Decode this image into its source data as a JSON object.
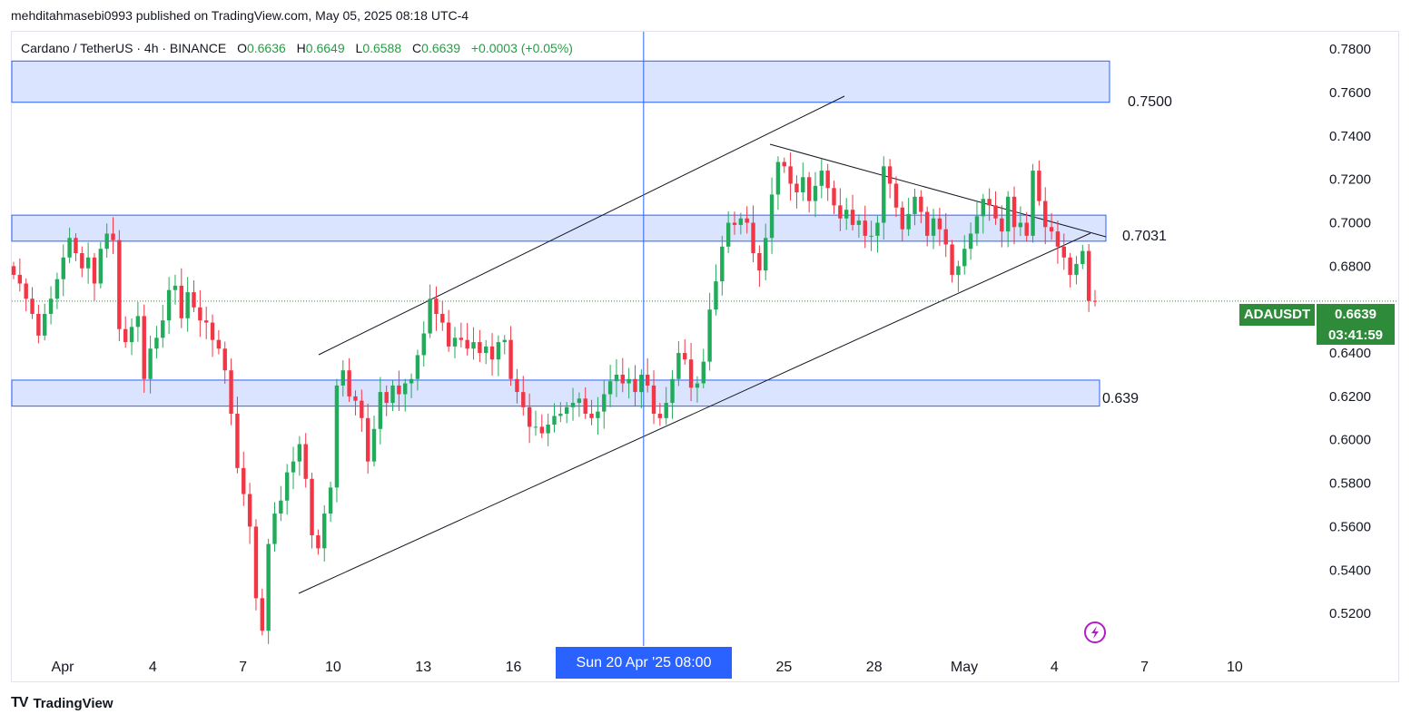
{
  "publish_line": "mehditahmasebi0993 published on TradingView.com, May 05, 2025 08:18 UTC-4",
  "legend": {
    "symbol": "Cardano / TetherUS · 4h · BINANCE",
    "open_label": "O",
    "open": "0.6636",
    "high_label": "H",
    "high": "0.6649",
    "low_label": "L",
    "low": "0.6588",
    "close_label": "C",
    "close": "0.6639",
    "change": "+0.0003 (+0.05%)"
  },
  "price_badge": {
    "symbol": "ADAUSDT",
    "price": "0.6639",
    "countdown": "03:41:59"
  },
  "crosshair_time_label": "Sun 20 Apr '25   08:00",
  "level_labels": {
    "upper": "0.7500",
    "middle": "0.7031",
    "lower": "0.639"
  },
  "brand": "TradingView",
  "colors": {
    "up": "#22ab5a",
    "down": "#f23645",
    "zone_fill": "#dbe4ff",
    "zone_stroke": "#2962ff",
    "crosshair": "#2962ff",
    "badge": "#2e8b3a"
  },
  "chart_data": {
    "type": "candlestick",
    "ylim": [
      0.505,
      0.788
    ],
    "y_ticks": [
      "0.7800",
      "0.7600",
      "0.7400",
      "0.7200",
      "0.7000",
      "0.6800",
      "0.6400",
      "0.6200",
      "0.6000",
      "0.5800",
      "0.5600",
      "0.5400",
      "0.5200"
    ],
    "x_ticks": [
      {
        "label": "Apr",
        "day": 1
      },
      {
        "label": "4",
        "day": 4
      },
      {
        "label": "7",
        "day": 7
      },
      {
        "label": "10",
        "day": 10
      },
      {
        "label": "13",
        "day": 13
      },
      {
        "label": "16",
        "day": 16
      },
      {
        "label": "25",
        "day": 25
      },
      {
        "label": "28",
        "day": 28
      },
      {
        "label": "May",
        "day": 31
      },
      {
        "label": "4",
        "day": 34
      },
      {
        "label": "7",
        "day": 37
      },
      {
        "label": "10",
        "day": 40
      }
    ],
    "zones": [
      {
        "from": 0.7555,
        "to": 0.7745
      },
      {
        "from": 0.6915,
        "to": 0.7035
      },
      {
        "from": 0.6155,
        "to": 0.6275
      }
    ],
    "crosshair_day": 20.33,
    "last_price": 0.6639,
    "close_series": [
      0.676,
      0.672,
      0.665,
      0.658,
      0.648,
      0.658,
      0.665,
      0.674,
      0.684,
      0.693,
      0.686,
      0.679,
      0.684,
      0.672,
      0.688,
      0.695,
      0.692,
      0.651,
      0.645,
      0.652,
      0.657,
      0.628,
      0.642,
      0.647,
      0.655,
      0.669,
      0.671,
      0.656,
      0.668,
      0.661,
      0.655,
      0.654,
      0.646,
      0.642,
      0.632,
      0.612,
      0.587,
      0.575,
      0.56,
      0.527,
      0.512,
      0.552,
      0.566,
      0.572,
      0.585,
      0.59,
      0.598,
      0.582,
      0.556,
      0.55,
      0.566,
      0.578,
      0.625,
      0.632,
      0.62,
      0.618,
      0.61,
      0.59,
      0.605,
      0.622,
      0.617,
      0.625,
      0.621,
      0.626,
      0.628,
      0.639,
      0.649,
      0.665,
      0.658,
      0.654,
      0.643,
      0.647,
      0.646,
      0.642,
      0.645,
      0.64,
      0.643,
      0.637,
      0.645,
      0.646,
      0.628,
      0.622,
      0.615,
      0.606,
      0.606,
      0.603,
      0.607,
      0.611,
      0.612,
      0.615,
      0.617,
      0.619,
      0.612,
      0.61,
      0.613,
      0.621,
      0.627,
      0.63,
      0.626,
      0.628,
      0.622,
      0.63,
      0.625,
      0.612,
      0.61,
      0.617,
      0.628,
      0.64,
      0.637,
      0.624,
      0.626,
      0.636,
      0.66,
      0.673,
      0.689,
      0.7,
      0.699,
      0.702,
      0.7,
      0.686,
      0.678,
      0.693,
      0.713,
      0.728,
      0.726,
      0.718,
      0.714,
      0.721,
      0.71,
      0.717,
      0.724,
      0.716,
      0.708,
      0.702,
      0.706,
      0.699,
      0.701,
      0.694,
      0.694,
      0.7,
      0.726,
      0.718,
      0.707,
      0.697,
      0.704,
      0.712,
      0.705,
      0.694,
      0.702,
      0.697,
      0.69,
      0.676,
      0.68,
      0.688,
      0.695,
      0.703,
      0.711,
      0.708,
      0.702,
      0.696,
      0.712,
      0.698,
      0.7,
      0.694,
      0.724,
      0.71,
      0.698,
      0.696,
      0.689,
      0.684,
      0.676,
      0.681,
      0.687,
      0.664,
      0.6639
    ]
  }
}
